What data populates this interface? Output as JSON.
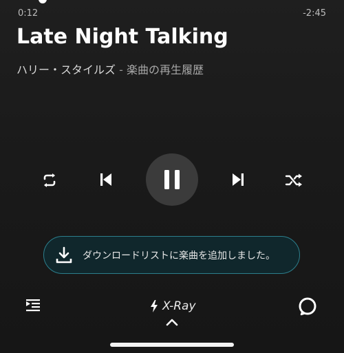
{
  "player": {
    "progress_fraction": 0.07,
    "elapsed": "0:12",
    "remaining": "-2:45",
    "track_title": "Late Night Talking",
    "artist": "ハリー・スタイルズ",
    "separator": " - ",
    "context": "楽曲の再生履歴",
    "state": "playing"
  },
  "controls": {
    "repeat": "repeat-icon",
    "previous": "skip-previous-icon",
    "pause": "pause-icon",
    "next": "skip-next-icon",
    "shuffle": "shuffle-icon"
  },
  "toast": {
    "icon": "download-icon",
    "message": "ダウンロードリストに楽曲を追加しました。"
  },
  "bottom_bar": {
    "queue_icon": "queue-icon",
    "xray_icon": "lightning-icon",
    "xray_label": "X-Ray",
    "expand_icon": "chevron-up-icon",
    "alexa_icon": "alexa-icon"
  },
  "colors": {
    "background": "#1b1b1b",
    "accent": "#2c7f8d",
    "pause_button_bg": "#3b3b3b"
  }
}
